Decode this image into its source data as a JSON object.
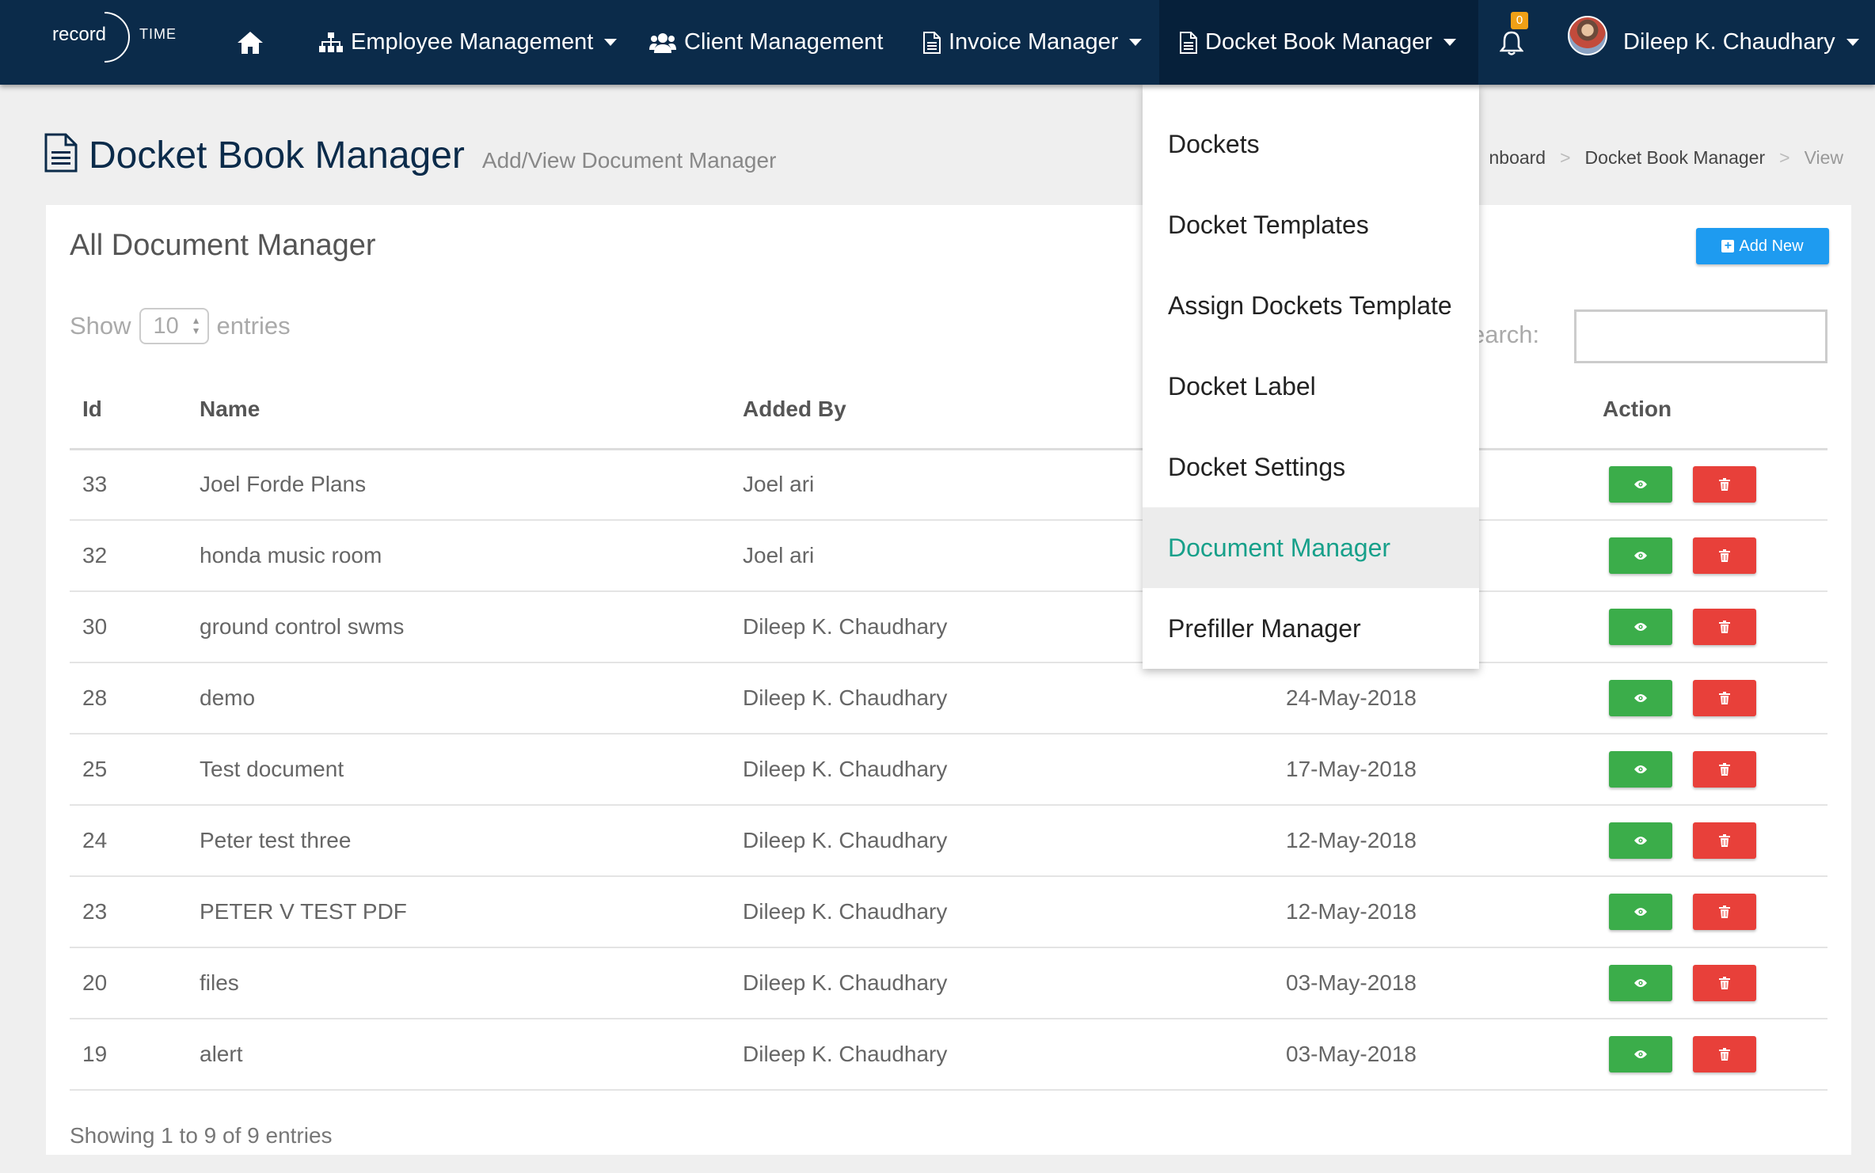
{
  "brand": {
    "left": "record",
    "right": "TIME"
  },
  "nav": {
    "employee": "Employee Management",
    "client": "Client Management",
    "invoice": "Invoice Manager",
    "docket": "Docket Book Manager",
    "notifications": "0",
    "user": "Dileep K. Chaudhary"
  },
  "dropdown": [
    "Dockets",
    "Docket Templates",
    "Assign Dockets Template",
    "Docket Label",
    "Docket Settings",
    "Document Manager",
    "Prefiller Manager"
  ],
  "header": {
    "title": "Docket Book Manager",
    "subtitle": "Add/View Document Manager"
  },
  "breadcrumb": {
    "c1": "nboard",
    "c2": "Docket Book Manager",
    "c3": "View"
  },
  "panel": {
    "title": "All Document Manager",
    "add_label": "Add New",
    "show_label": "Show",
    "page_size": "10",
    "entries_label": "entries",
    "search_label": "earch:",
    "info": "Showing 1 to 9 of 9 entries"
  },
  "table": {
    "columns": [
      "Id",
      "Name",
      "Added By",
      "",
      "Action"
    ],
    "rows": [
      {
        "id": "33",
        "name": "Joel Forde Plans",
        "added_by": "Joel ari",
        "date": ""
      },
      {
        "id": "32",
        "name": "honda music room",
        "added_by": "Joel ari",
        "date": ""
      },
      {
        "id": "30",
        "name": "ground control swms",
        "added_by": "Dileep K. Chaudhary",
        "date": ""
      },
      {
        "id": "28",
        "name": "demo",
        "added_by": "Dileep K. Chaudhary",
        "date": "24-May-2018"
      },
      {
        "id": "25",
        "name": "Test document",
        "added_by": "Dileep K. Chaudhary",
        "date": "17-May-2018"
      },
      {
        "id": "24",
        "name": "Peter test three",
        "added_by": "Dileep K. Chaudhary",
        "date": "12-May-2018"
      },
      {
        "id": "23",
        "name": "PETER V TEST PDF",
        "added_by": "Dileep K. Chaudhary",
        "date": "12-May-2018"
      },
      {
        "id": "20",
        "name": "files",
        "added_by": "Dileep K. Chaudhary",
        "date": "03-May-2018"
      },
      {
        "id": "19",
        "name": "alert",
        "added_by": "Dileep K. Chaudhary",
        "date": "03-May-2018"
      }
    ]
  },
  "colors": {
    "navbar": "#0b2b4a",
    "view": "#3bad4a",
    "delete": "#e8403a",
    "add": "#1e9bf0",
    "active_menu": "#17a08a"
  }
}
